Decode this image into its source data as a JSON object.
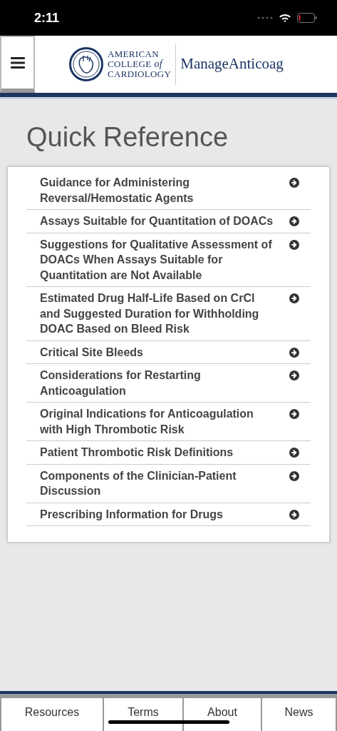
{
  "status_bar": {
    "time": "2:11"
  },
  "header": {
    "logo_lines": [
      "AMERICAN",
      "COLLEGE",
      "of",
      "CARDIOLOGY"
    ],
    "app_name": "ManageAnticoag"
  },
  "page_title": "Quick Reference",
  "items": [
    {
      "label": "Guidance for Administering Reversal/Hemostatic Agents"
    },
    {
      "label": "Assays Suitable for Quantitation of DOACs"
    },
    {
      "label": "Suggestions for Qualitative Assessment of DOACs When Assays Suitable for Quantitation are Not Available"
    },
    {
      "label": "Estimated Drug Half-Life Based on CrCl and Suggested Duration for Withholding DOAC Based on Bleed Risk"
    },
    {
      "label": "Critical Site Bleeds"
    },
    {
      "label": "Considerations for Restarting Anticoagulation"
    },
    {
      "label": "Original Indications for Anticoagulation with High Thrombotic Risk"
    },
    {
      "label": "Patient Thrombotic Risk Definitions"
    },
    {
      "label": "Components of the Clinician-Patient Discussion"
    },
    {
      "label": "Prescribing Information for Drugs"
    }
  ],
  "footer_tabs": [
    "Resources",
    "Terms",
    "About",
    "News"
  ]
}
